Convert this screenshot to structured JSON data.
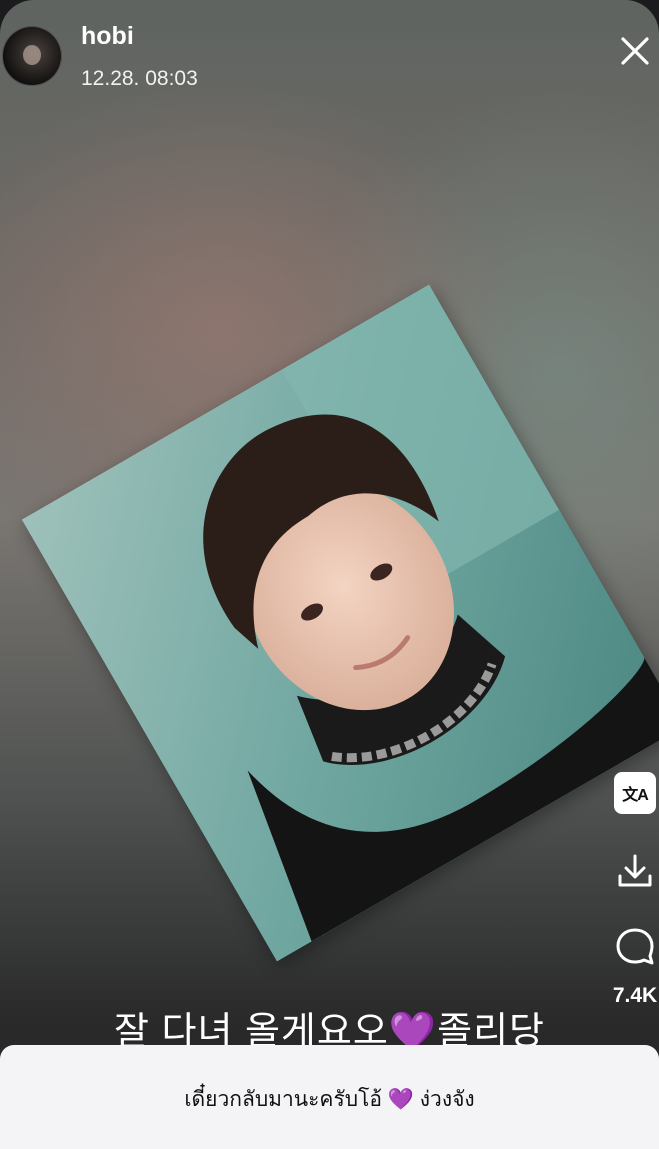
{
  "header": {
    "username": "hobi",
    "timestamp": "12.28. 08:03"
  },
  "icons": {
    "close": "close-icon",
    "translate": "translate-icon",
    "download": "download-icon",
    "comment": "comment-icon"
  },
  "actions": {
    "translate_glyph": "文A",
    "comment_count": "7.4K"
  },
  "caption": {
    "before": "잘 다녀 올게요오",
    "emoji": "💜",
    "after": "졸리당"
  },
  "translation": {
    "before": "เดี๋ยวกลับมานะครับโอ้ ",
    "emoji": "💜",
    "after": " ง่วงจัง"
  },
  "colors": {
    "heart": "#9a3ff0",
    "panel_bg": "#f4f4f6"
  }
}
